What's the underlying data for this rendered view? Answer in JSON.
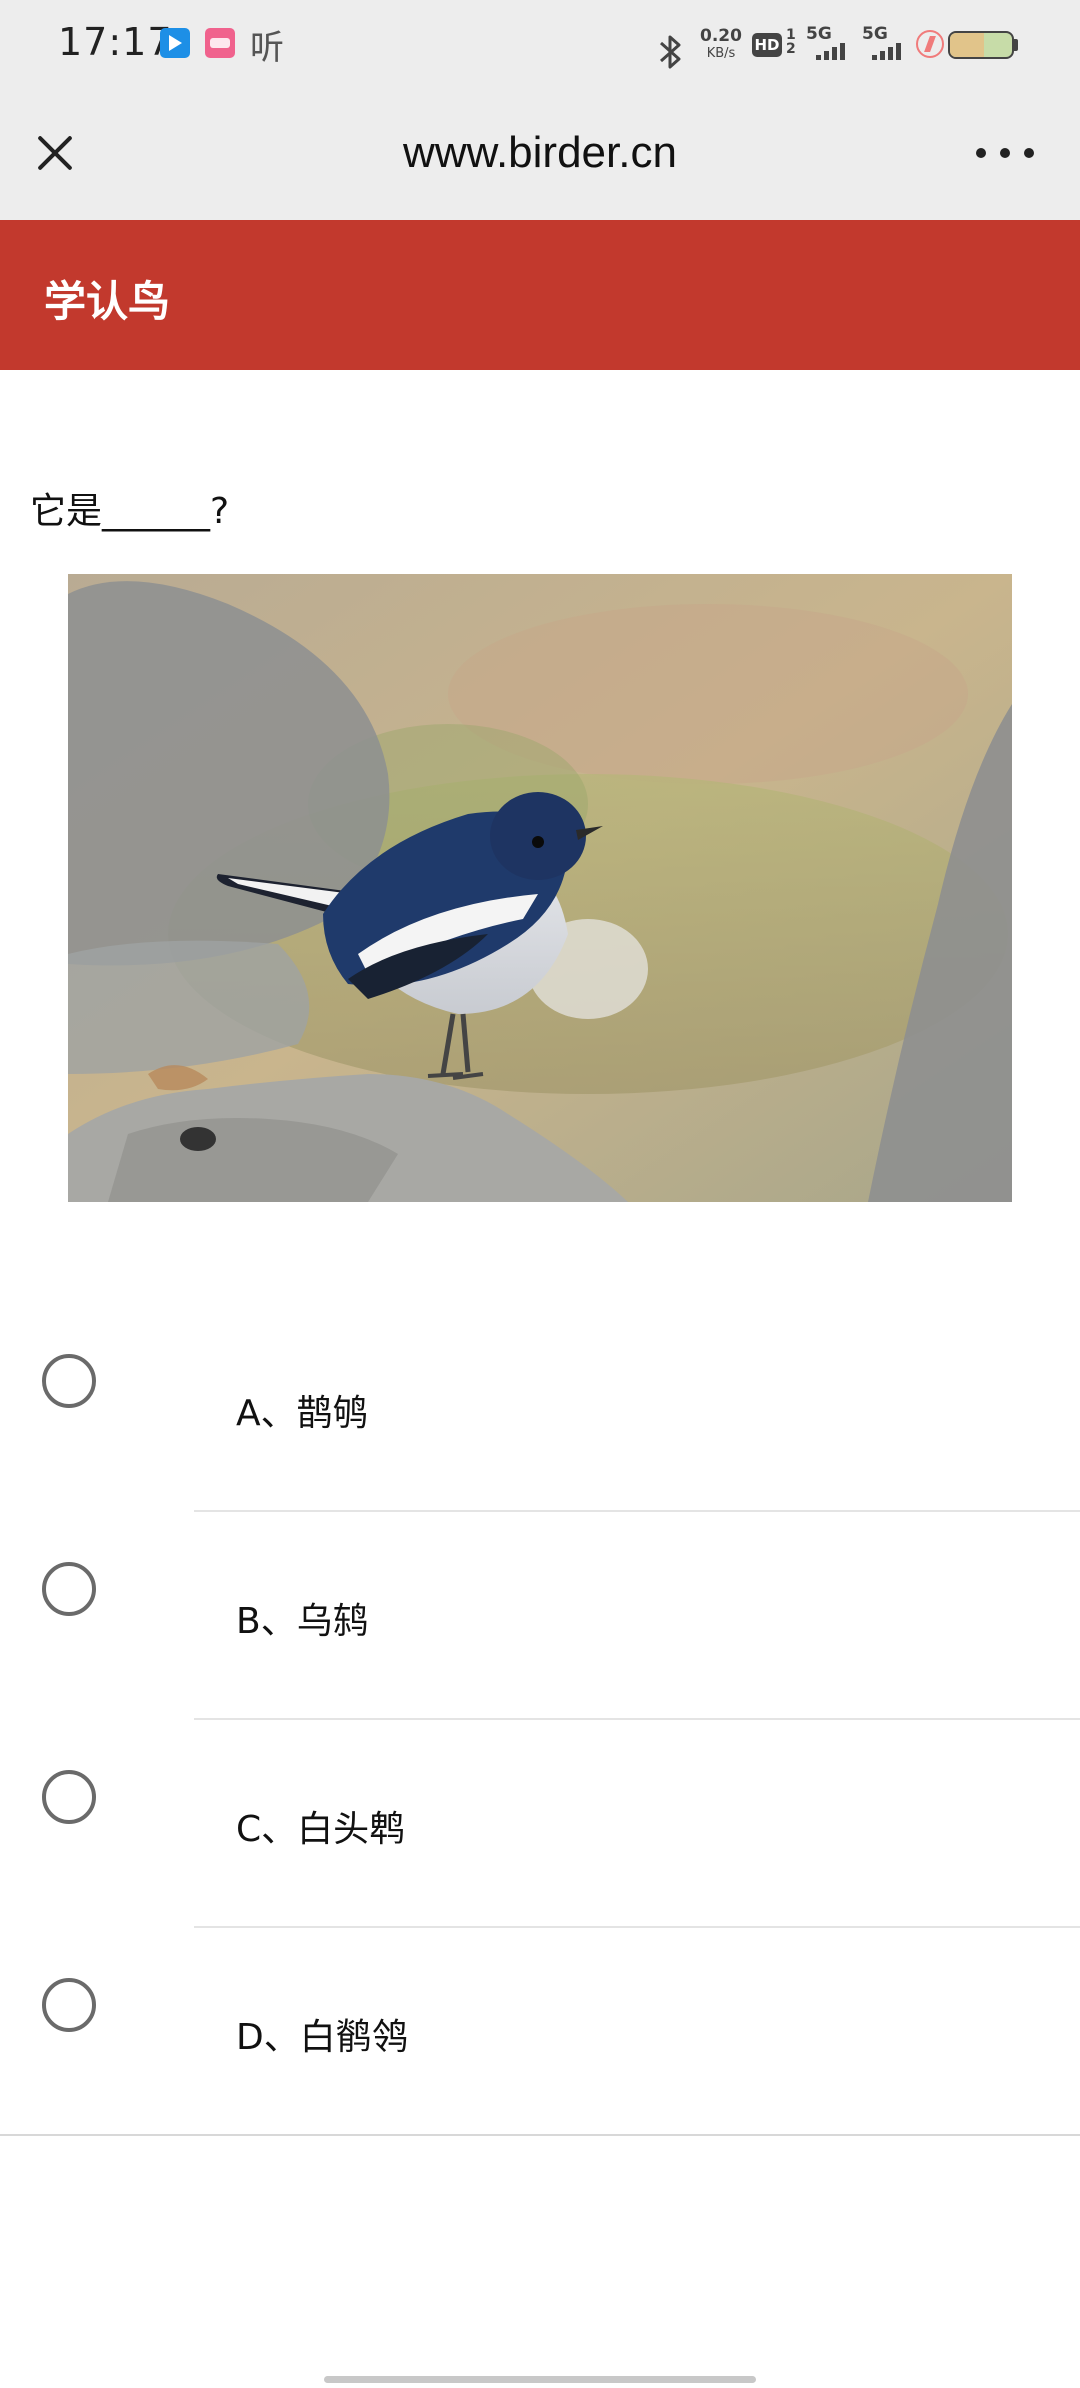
{
  "status_bar": {
    "time": "17:17",
    "app_icons": [
      "video-app-icon",
      "bilibili-icon"
    ],
    "listen_label": "听",
    "network_speed": "0.20",
    "network_speed_unit": "KB/s",
    "hd_label": "HD",
    "hd_sub": "1 2",
    "signal1_label": "5G",
    "signal2_label": "5G",
    "battery_level": 0.55,
    "charging": true
  },
  "browser": {
    "url_title": "www.birder.cn",
    "close_icon": "close-icon",
    "more_icon": "more-dots-icon"
  },
  "header": {
    "title": "学认鸟",
    "color": "#c2392d"
  },
  "quiz": {
    "question": "它是______?",
    "image": "bird-photo (blue-black bird with white wing patch on rock)",
    "options": [
      {
        "label": "A、鹊鸲"
      },
      {
        "label": "B、乌鸫"
      },
      {
        "label": "C、白头鹎"
      },
      {
        "label": "D、白鹡鸰"
      }
    ]
  }
}
